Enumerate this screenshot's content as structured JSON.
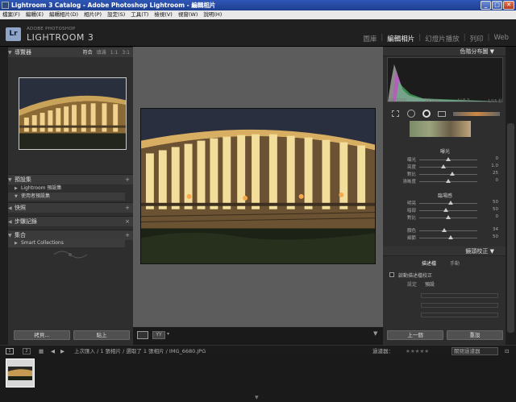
{
  "window": {
    "title": "Lightroom 3 Catalog - Adobe Photoshop Lightroom - 編輯相片"
  },
  "menu": [
    "檔案(F)",
    "編輯(E)",
    "編輯相片(D)",
    "相片(P)",
    "設定(S)",
    "工具(T)",
    "檢視(V)",
    "視窗(W)",
    "說明(H)"
  ],
  "brand": {
    "small": "ADOBE PHOTOSHOP",
    "big": "LIGHTROOM 3",
    "badge": "Lr"
  },
  "modules": [
    "圖庫",
    "編輯相片",
    "幻燈片播放",
    "列印",
    "Web"
  ],
  "modules_active": 1,
  "left": {
    "navigator": {
      "title": "導覽器",
      "opts": [
        "符合",
        "填滿",
        "1:1",
        "3:1"
      ],
      "active_opt": 0
    },
    "presets": {
      "title": "預設集",
      "items": [
        "Lightroom 預設集",
        "使用者預設集"
      ],
      "add": "+"
    },
    "snapshots": {
      "title": "快照",
      "add": "+"
    },
    "history": {
      "title": "步驟記錄",
      "close": "×"
    },
    "collections": {
      "title": "集合",
      "items": [
        "Smart Collections"
      ],
      "add": "+"
    },
    "buttons": {
      "copy": "拷貝...",
      "paste": "貼上"
    }
  },
  "right": {
    "histogram": {
      "title": "色階分布圖",
      "iso": "ISO 3200",
      "focal": "18 mm",
      "aperture": "f / 6.3",
      "shutter": "1/15 秒"
    },
    "basic_sections": {
      "tone_title": "曝光",
      "presence_title": "臨場感"
    },
    "sliders_a": [
      {
        "label": "曝光",
        "value": "0"
      },
      {
        "label": "亮度",
        "value": "1.0"
      },
      {
        "label": "對比",
        "value": "25"
      },
      {
        "label": "清晰度",
        "value": "0"
      }
    ],
    "sliders_b": [
      {
        "label": "明亮",
        "value": "50"
      },
      {
        "label": "暗部",
        "value": "50"
      },
      {
        "label": "對比",
        "value": "0"
      }
    ],
    "sliders_c": [
      {
        "label": "顏色",
        "value": "34"
      },
      {
        "label": "細節",
        "value": "50"
      }
    ],
    "lens": {
      "title": "鏡頭校正",
      "tabs": [
        "描述檔",
        "手動"
      ],
      "checkbox": "啟動描述檔校正",
      "setup_label": "設定",
      "setup_value": "預設"
    },
    "buttons": {
      "prev": "上一個",
      "reset": "重設"
    }
  },
  "filmbar": {
    "pages": [
      "1",
      "2"
    ],
    "info": "上次匯入 / 1 張相片 / 選取了 1 張相片 / IMG_6680.JPG",
    "filter_label": "過濾器：",
    "filter_value": "關閉過濾器"
  },
  "colors": {
    "accent": "#f0f0f0",
    "panel": "#2e2e2e",
    "titlebar": "#2f57b8"
  }
}
